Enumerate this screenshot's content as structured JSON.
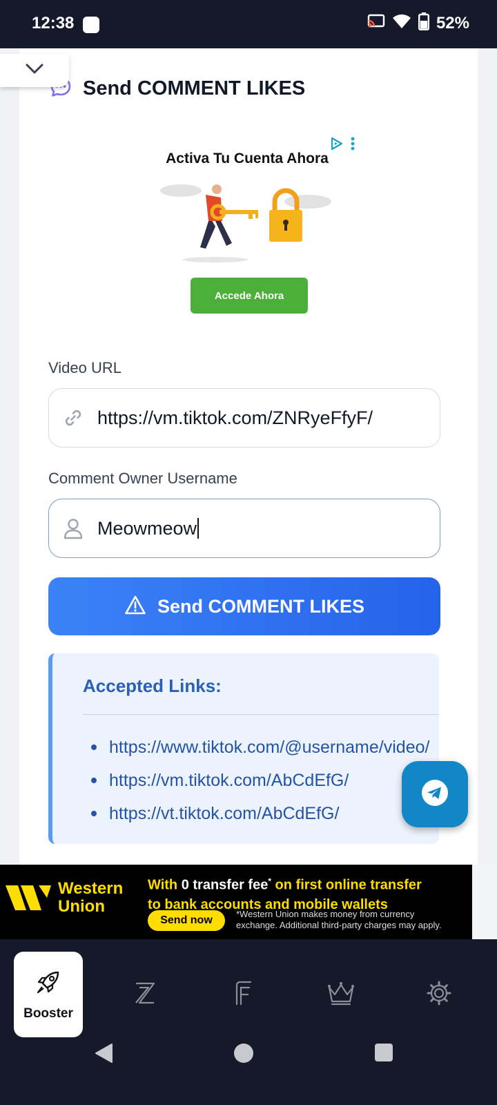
{
  "status_bar": {
    "time": "12:38",
    "battery": "52%",
    "icons": [
      "notification-icon",
      "cast-icon",
      "wifi-icon",
      "battery-icon"
    ]
  },
  "card": {
    "title": "Send COMMENT LIKES",
    "title_icon": "chat-bubble-icon",
    "collapse_icon": "chevron-down-icon"
  },
  "ad": {
    "headline": "Activa Tu Cuenta Ahora",
    "cta": "Accede Ahora"
  },
  "form": {
    "video_url": {
      "label": "Video URL",
      "value": "https://vm.tiktok.com/ZNRyeFfyF/",
      "icon": "link-icon"
    },
    "username": {
      "label": "Comment Owner Username",
      "value": "Meowmeow",
      "icon": "user-icon"
    },
    "submit": {
      "label": "Send COMMENT LIKES",
      "icon": "warning-icon"
    }
  },
  "accepted_links": {
    "title": "Accepted Links:",
    "items": [
      "https://www.tiktok.com/@username/video/",
      "https://vm.tiktok.com/AbCdEfG/",
      "https://vt.tiktok.com/AbCdEfG/"
    ]
  },
  "fab": {
    "icon": "telegram-icon"
  },
  "wu_banner": {
    "logo_line1": "Western",
    "logo_line2": "Union",
    "headline_part1": "With ",
    "headline_bold": "0 transfer fee",
    "headline_sup": "*",
    "headline_part2": " on first online transfer",
    "headline_line2": "to bank accounts and mobile wallets",
    "cta": "Send now",
    "disclaimer_line1": "*Western Union makes money from currency",
    "disclaimer_line2": "exchange. Additional third-party charges may apply."
  },
  "bottom_nav": {
    "items": [
      {
        "label": "Booster",
        "icon": "rocket-icon",
        "active": true
      },
      {
        "label": "",
        "icon": "z-icon",
        "active": false
      },
      {
        "label": "",
        "icon": "f-icon",
        "active": false
      },
      {
        "label": "",
        "icon": "crown-icon",
        "active": false
      },
      {
        "label": "",
        "icon": "gear-icon",
        "active": false
      }
    ]
  },
  "colors": {
    "primary": "#3b82f6",
    "status_bar": "#141a2a",
    "accent_text": "#2b5fb5",
    "telegram": "#1187c8",
    "wu_yellow": "#ffdd00"
  }
}
